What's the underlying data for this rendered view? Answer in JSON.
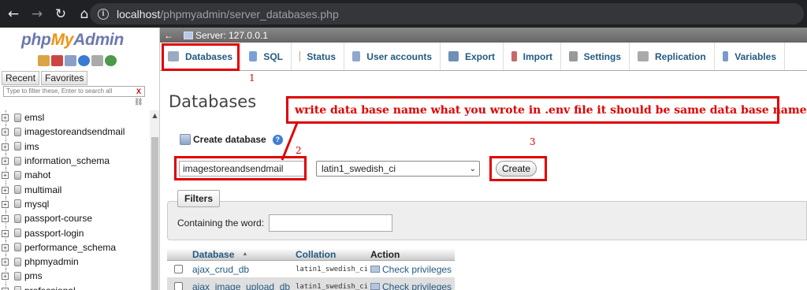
{
  "browser": {
    "url_host": "localhost",
    "url_path": "/phpmyadmin/server_databases.php"
  },
  "sidebar": {
    "logo": {
      "php": "php",
      "my": "My",
      "admin": "Admin"
    },
    "tabs": [
      "Recent",
      "Favorites"
    ],
    "filter_placeholder": "Type to filter these, Enter to search all",
    "filter_clear": "X",
    "databases": [
      "emsl",
      "imagestoreandsendmail",
      "ims",
      "information_schema",
      "mahot",
      "multimail",
      "mysql",
      "passport-course",
      "passport-login",
      "performance_schema",
      "phpmyadmin",
      "pms",
      "professional"
    ]
  },
  "server_bar": {
    "collapse": "←",
    "label": "Server: 127.0.0.1"
  },
  "menu": [
    {
      "label": "Databases",
      "icon": "database-icon",
      "color": "#9aa9c4"
    },
    {
      "label": "SQL",
      "icon": "sql-icon",
      "color": "#7aa1d6"
    },
    {
      "label": "Status",
      "icon": "status-icon",
      "color": "#c7a26a"
    },
    {
      "label": "User accounts",
      "icon": "users-icon",
      "color": "#8fa8d0"
    },
    {
      "label": "Export",
      "icon": "export-icon",
      "color": "#6f8fb8"
    },
    {
      "label": "Import",
      "icon": "import-icon",
      "color": "#c56a6a"
    },
    {
      "label": "Settings",
      "icon": "settings-icon",
      "color": "#999999"
    },
    {
      "label": "Replication",
      "icon": "replication-icon",
      "color": "#aaaaaa"
    },
    {
      "label": "Variables",
      "icon": "variables-icon",
      "color": "#7a9bc8"
    }
  ],
  "main": {
    "title": "Databases",
    "create_label": "Create database",
    "help": "?",
    "db_name_value": "imagestoreandsendmail",
    "collation_value": "latin1_swedish_ci",
    "create_button": "Create",
    "filters_legend": "Filters",
    "containing_label": "Containing the word:",
    "table": {
      "headers": {
        "database": "Database",
        "sort": "▲",
        "collation": "Collation",
        "action": "Action"
      },
      "rows": [
        {
          "name": "ajax_crud_db",
          "collation": "latin1_swedish_ci",
          "action": "Check privileges"
        },
        {
          "name": "ajax_image_upload_db",
          "collation": "latin1_swedish_ci",
          "action": "Check privileges"
        }
      ]
    }
  },
  "annotations": {
    "n1": "1",
    "n2": "2",
    "n3": "3",
    "note": "write data base name what you wrote in .env file it should be same data base name"
  }
}
